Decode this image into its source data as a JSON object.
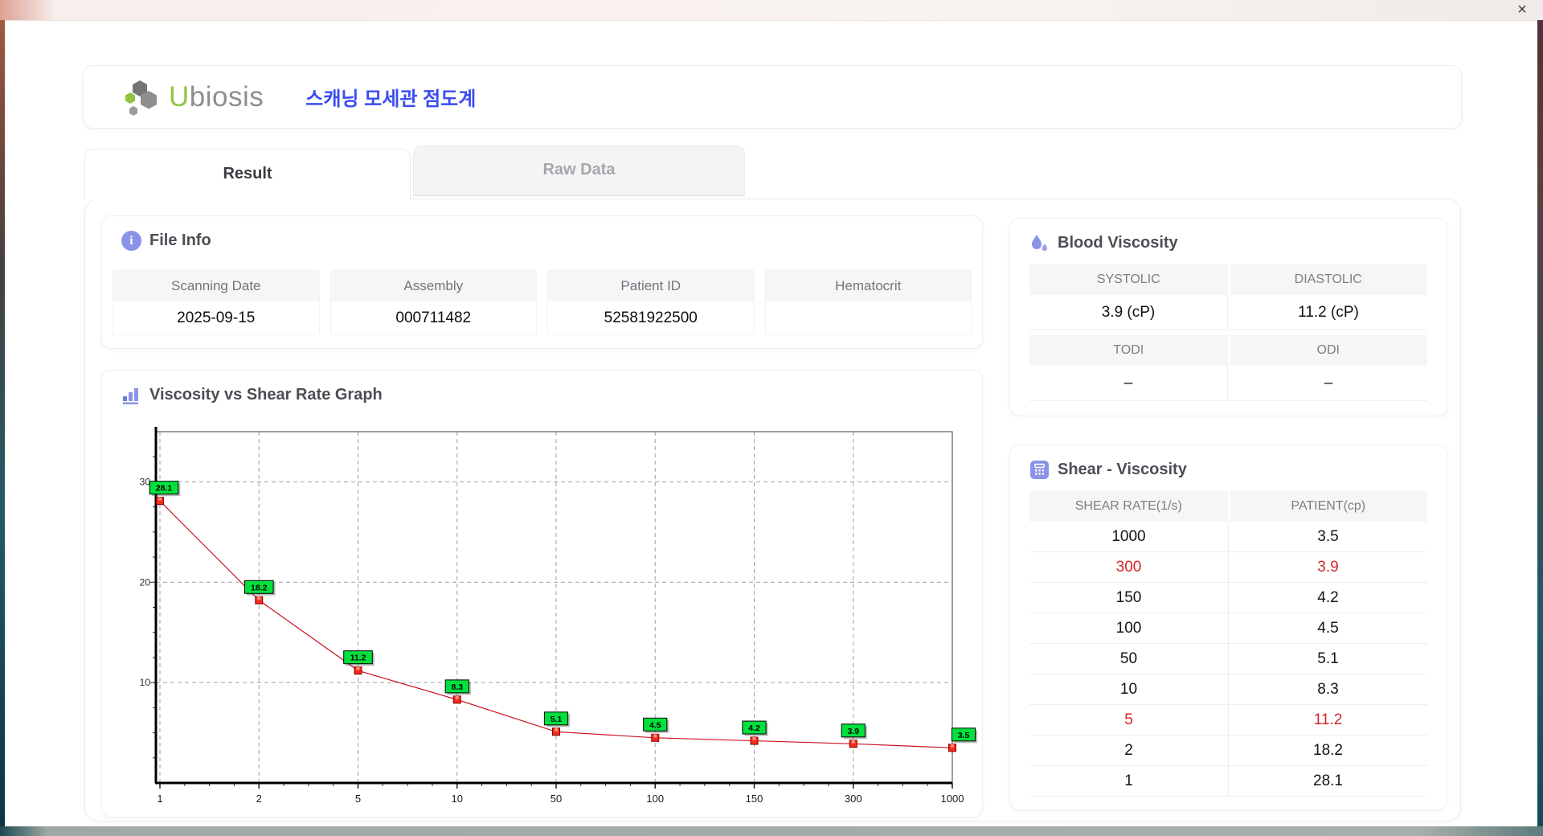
{
  "titlebar": {
    "close_icon": "×"
  },
  "header": {
    "logo_u": "U",
    "logo_rest": "biosis",
    "app_title": "스캐닝 모세관 점도계"
  },
  "tabs": [
    {
      "label": "Result",
      "active": true
    },
    {
      "label": "Raw Data",
      "active": false
    }
  ],
  "file_info": {
    "title": "File Info",
    "fields": [
      {
        "label": "Scanning Date",
        "value": "2025-09-15"
      },
      {
        "label": "Assembly",
        "value": "000711482"
      },
      {
        "label": "Patient ID",
        "value": "52581922500"
      },
      {
        "label": "Hematocrit",
        "value": ""
      }
    ]
  },
  "blood_viscosity": {
    "title": "Blood Viscosity",
    "row1": {
      "headers": [
        "SYSTOLIC",
        "DIASTOLIC"
      ],
      "values": [
        "3.9 (cP)",
        "11.2 (cP)"
      ]
    },
    "row2": {
      "headers": [
        "TODI",
        "ODI"
      ],
      "values": [
        "–",
        "–"
      ]
    }
  },
  "graph": {
    "title": "Viscosity vs Shear Rate Graph"
  },
  "shear_viscosity": {
    "title": "Shear - Viscosity",
    "columns": [
      "SHEAR RATE(1/s)",
      "PATIENT(cp)"
    ],
    "rows": [
      {
        "shear": "1000",
        "patient": "3.5",
        "highlight": false
      },
      {
        "shear": "300",
        "patient": "3.9",
        "highlight": true
      },
      {
        "shear": "150",
        "patient": "4.2",
        "highlight": false
      },
      {
        "shear": "100",
        "patient": "4.5",
        "highlight": false
      },
      {
        "shear": "50",
        "patient": "5.1",
        "highlight": false
      },
      {
        "shear": "10",
        "patient": "8.3",
        "highlight": false
      },
      {
        "shear": "5",
        "patient": "11.2",
        "highlight": true
      },
      {
        "shear": "2",
        "patient": "18.2",
        "highlight": false
      },
      {
        "shear": "1",
        "patient": "28.1",
        "highlight": false
      }
    ]
  },
  "chart_data": {
    "type": "line",
    "title": "Viscosity vs Shear Rate Graph",
    "categories": [
      "1",
      "2",
      "5",
      "10",
      "50",
      "100",
      "150",
      "300",
      "1000"
    ],
    "values": [
      28.1,
      18.2,
      11.2,
      8.3,
      5.1,
      4.5,
      4.2,
      3.9,
      3.5
    ],
    "point_labels": [
      "28.1",
      "18.2",
      "11.2",
      "8.3",
      "5.1",
      "4.5",
      "4.2",
      "3.9",
      "3.5"
    ],
    "xlabel": "",
    "ylabel": "",
    "ylim": [
      0,
      35
    ],
    "yticks": [
      10,
      20,
      30
    ],
    "grid": "dashed",
    "legend": "none",
    "line_color": "#cc1122",
    "marker_color": "#f42b1d",
    "marker_border": "#8b0000",
    "label_bg": "#00e13e",
    "label_border": "#000000"
  },
  "colors": {
    "accent_blue": "#3a4df2",
    "icon_periwinkle": "#8a93e8",
    "logo_green": "#8dc63f",
    "logo_gray": "#8e8e8e",
    "highlight_red": "#d22626",
    "header_fill": "#f6f6f7"
  }
}
